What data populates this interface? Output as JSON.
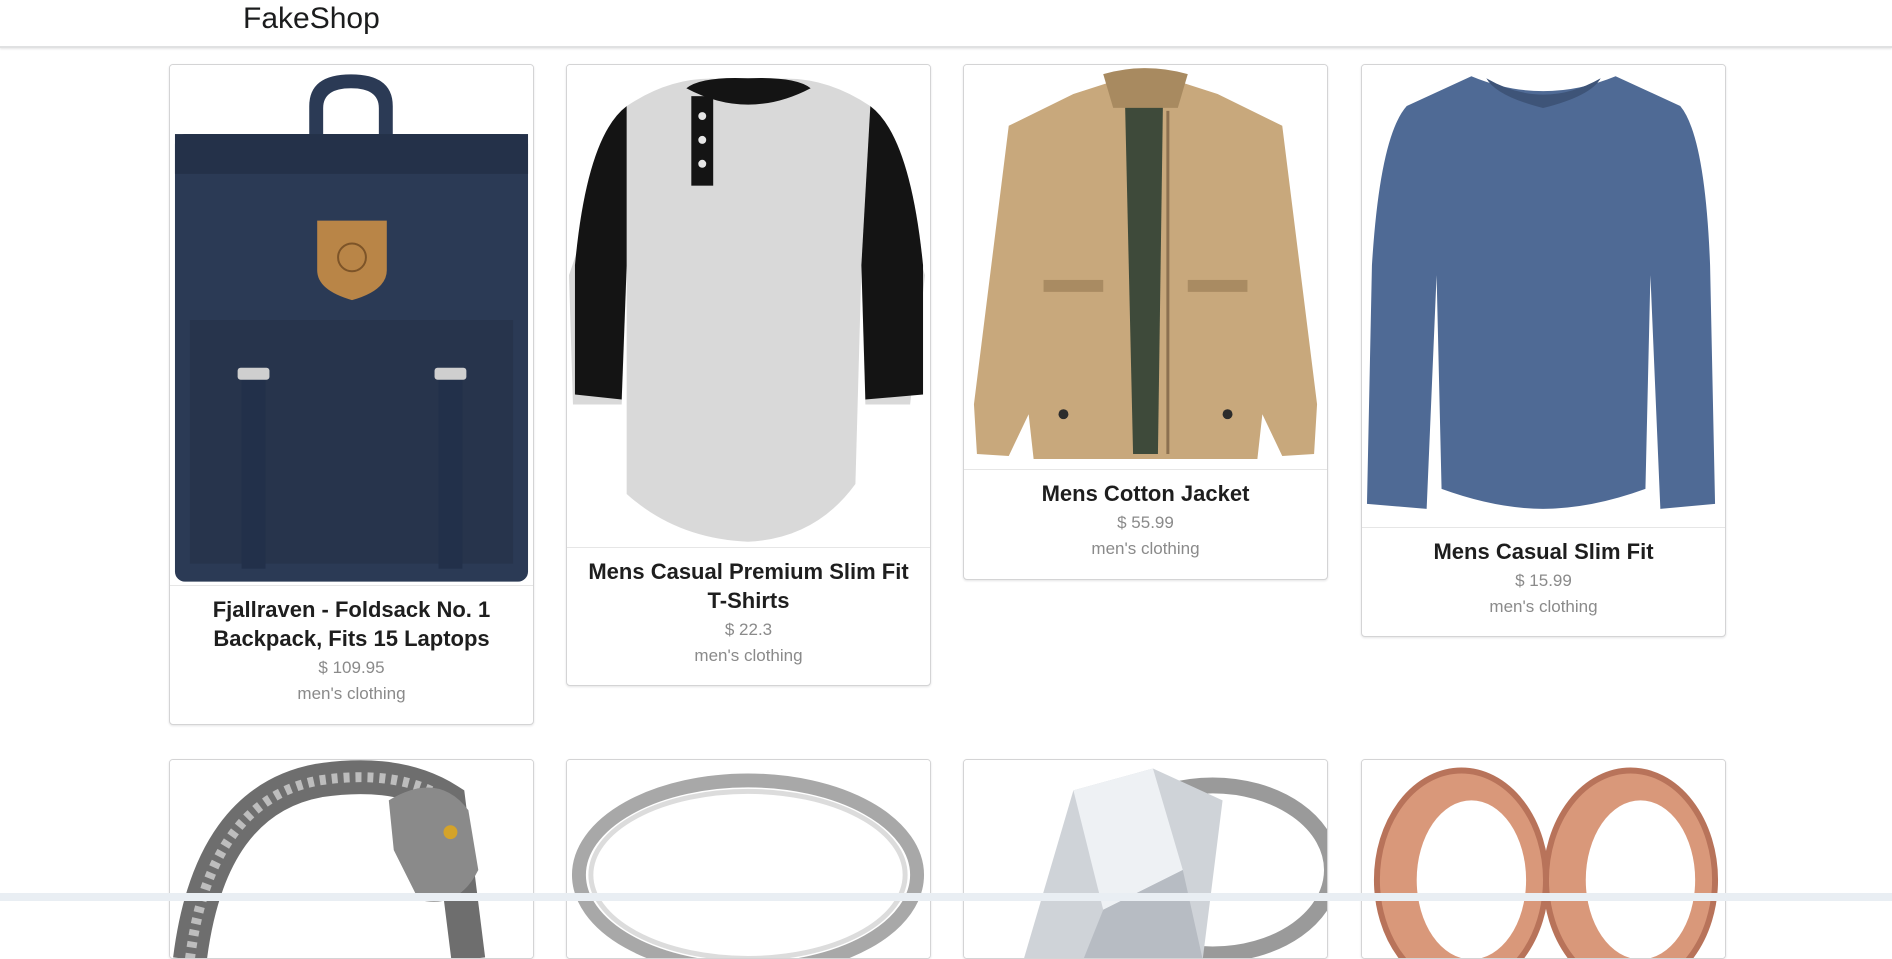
{
  "header": {
    "brand": "FakeShop"
  },
  "products": [
    {
      "title": "Fjallraven - Foldsack No. 1 Backpack, Fits 15 Laptops",
      "price": "$ 109.95",
      "category": "men's clothing",
      "image_icon": "backpack-image"
    },
    {
      "title": "Mens Casual Premium Slim Fit T-Shirts",
      "price": "$ 22.3",
      "category": "men's clothing",
      "image_icon": "tshirt-image"
    },
    {
      "title": "Mens Cotton Jacket",
      "price": "$ 55.99",
      "category": "men's clothing",
      "image_icon": "jacket-image"
    },
    {
      "title": "Mens Casual Slim Fit",
      "price": "$ 15.99",
      "category": "men's clothing",
      "image_icon": "longsleeve-image"
    },
    {
      "image_icon": "dragon-bracelet-image"
    },
    {
      "image_icon": "silver-ring-image"
    },
    {
      "image_icon": "diamond-ring-image"
    },
    {
      "image_icon": "rose-gold-plugs-image"
    }
  ],
  "colors": {
    "navy_bag": "#2b3a55",
    "khaki_jacket": "#c8a87c",
    "blue_shirt": "#4f6a95",
    "rose_gold": "#d9987a"
  }
}
